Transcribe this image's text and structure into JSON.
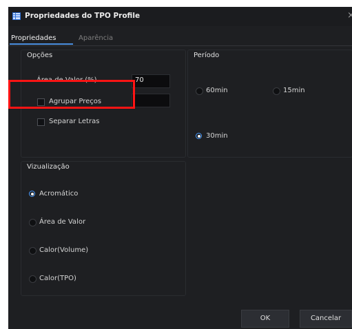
{
  "window": {
    "title": "Propriedades do TPO Profile",
    "app_icon": "grid-table-icon",
    "close_glyph": "×"
  },
  "tabs": [
    {
      "label": "Propriedades",
      "active": true
    },
    {
      "label": "Aparência",
      "active": false
    }
  ],
  "opcoes": {
    "title": "Opções",
    "area_valor_label": "Área de Valor (%)",
    "area_valor_value": "70",
    "agrupar_label": "Agrupar Preços",
    "agrupar_value": "",
    "agrupar_checked": false,
    "separar_label": "Separar Letras",
    "separar_checked": false
  },
  "periodo": {
    "title": "Período",
    "options": [
      {
        "label": "60min",
        "selected": false
      },
      {
        "label": "15min",
        "selected": false
      },
      {
        "label": "30min",
        "selected": true
      }
    ]
  },
  "visualizacao": {
    "title": "Vizualização",
    "options": [
      {
        "label": "Acromático",
        "selected": true
      },
      {
        "label": "Área de Valor",
        "selected": false
      },
      {
        "label": "Calor(Volume)",
        "selected": false
      },
      {
        "label": "Calor(TPO)",
        "selected": false
      }
    ]
  },
  "buttons": {
    "ok": "OK",
    "cancel": "Cancelar"
  },
  "colors": {
    "background": "#1e1f22",
    "accent": "#4a8fe0",
    "highlight": "#ff1414"
  }
}
